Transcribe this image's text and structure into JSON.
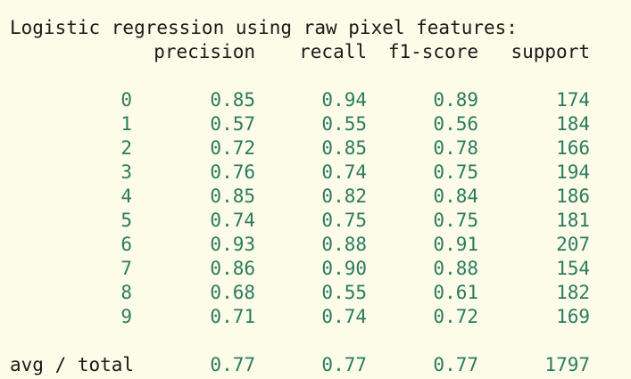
{
  "report": {
    "title": "Logistic regression using raw pixel features:",
    "headers": {
      "precision": "precision",
      "recall": "recall",
      "f1": "f1-score",
      "support": "support"
    },
    "rows": [
      {
        "label": "0",
        "precision": "0.85",
        "recall": "0.94",
        "f1": "0.89",
        "support": "174"
      },
      {
        "label": "1",
        "precision": "0.57",
        "recall": "0.55",
        "f1": "0.56",
        "support": "184"
      },
      {
        "label": "2",
        "precision": "0.72",
        "recall": "0.85",
        "f1": "0.78",
        "support": "166"
      },
      {
        "label": "3",
        "precision": "0.76",
        "recall": "0.74",
        "f1": "0.75",
        "support": "194"
      },
      {
        "label": "4",
        "precision": "0.85",
        "recall": "0.82",
        "f1": "0.84",
        "support": "186"
      },
      {
        "label": "5",
        "precision": "0.74",
        "recall": "0.75",
        "f1": "0.75",
        "support": "181"
      },
      {
        "label": "6",
        "precision": "0.93",
        "recall": "0.88",
        "f1": "0.91",
        "support": "207"
      },
      {
        "label": "7",
        "precision": "0.86",
        "recall": "0.90",
        "f1": "0.88",
        "support": "154"
      },
      {
        "label": "8",
        "precision": "0.68",
        "recall": "0.55",
        "f1": "0.61",
        "support": "182"
      },
      {
        "label": "9",
        "precision": "0.71",
        "recall": "0.74",
        "f1": "0.72",
        "support": "169"
      }
    ],
    "avg": {
      "label": "avg / total",
      "precision": "0.77",
      "recall": "0.77",
      "f1": "0.77",
      "support": "1797"
    }
  },
  "colors": {
    "background": "#fcfce9",
    "text": "#1a1a1a",
    "number": "#2b7a5f"
  }
}
